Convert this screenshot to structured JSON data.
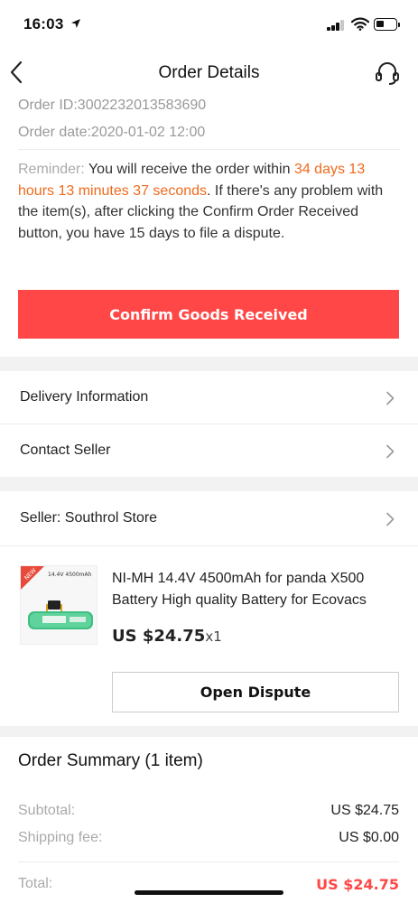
{
  "status_bar": {
    "time": "16:03"
  },
  "nav": {
    "title": "Order Details"
  },
  "order": {
    "id_text": "Order ID:3002232013583690",
    "date_text": "Order date:2020-01-02 12:00"
  },
  "reminder": {
    "label": "Reminder:",
    "text_before": " You will receive the order within ",
    "countdown": "34 days 13 hours 13 minutes 37 seconds",
    "text_after": ". If there's any problem with the item(s), after clicking the Confirm Order Received button, you have 15 days to file a dispute."
  },
  "confirm_button": {
    "label": "Confirm Goods Received"
  },
  "menu": {
    "delivery": "Delivery Information",
    "contact": "Contact Seller"
  },
  "seller": {
    "label": "Seller: Southrol Store"
  },
  "product": {
    "title_line1": "NI-MH 14.4V 4500mAh for panda X500",
    "title_line2": "Battery High quality Battery for Ecovacs",
    "price": "US $24.75",
    "qty": "x1",
    "image_badge": "NEW",
    "image_label": "14.4V  4500mAh"
  },
  "dispute_button": {
    "label": "Open Dispute"
  },
  "summary": {
    "title": "Order Summary (1 item)",
    "subtotal_label": "Subtotal:",
    "subtotal_value": "US $24.75",
    "shipping_label": "Shipping fee:",
    "shipping_value": "US $0.00",
    "total_label": "Total:",
    "total_value": "US $24.75"
  },
  "colors": {
    "accent_red": "#ff4747",
    "countdown_orange": "#f06a1c",
    "muted_gray": "#999999"
  },
  "icons": [
    "location-arrow-icon",
    "cellular-signal-icon",
    "wifi-icon",
    "battery-icon",
    "back-chevron-icon",
    "customer-service-icon",
    "chevron-right-icon"
  ]
}
